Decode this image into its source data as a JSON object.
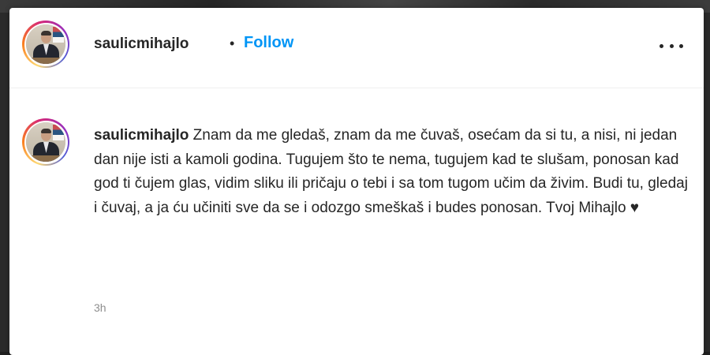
{
  "post": {
    "username": "saulicmihajlo",
    "separator": "•",
    "follow_label": "Follow",
    "more_icon": "more-horizontal-icon"
  },
  "caption": {
    "username": "saulicmihajlo",
    "text": "Znam da me gledaš, znam da me čuvaš, osećam da si tu, a nisi, ni jedan dan nije isti a kamoli godina. Tugujem što te nema, tugujem kad te slušam, ponosan kad god ti čujem glas, vidim sliku ili pričaju o tebi i sa tom tugom učim da živim. Budi tu, gledaj i čuvaj, a ja ću učiniti sve da se i odozgo smeškaš i budes ponosan. Tvoj Mihajlo ♥",
    "timestamp": "3h"
  },
  "colors": {
    "follow": "#0095f6",
    "text": "#262626",
    "muted": "#8e8e8e"
  }
}
